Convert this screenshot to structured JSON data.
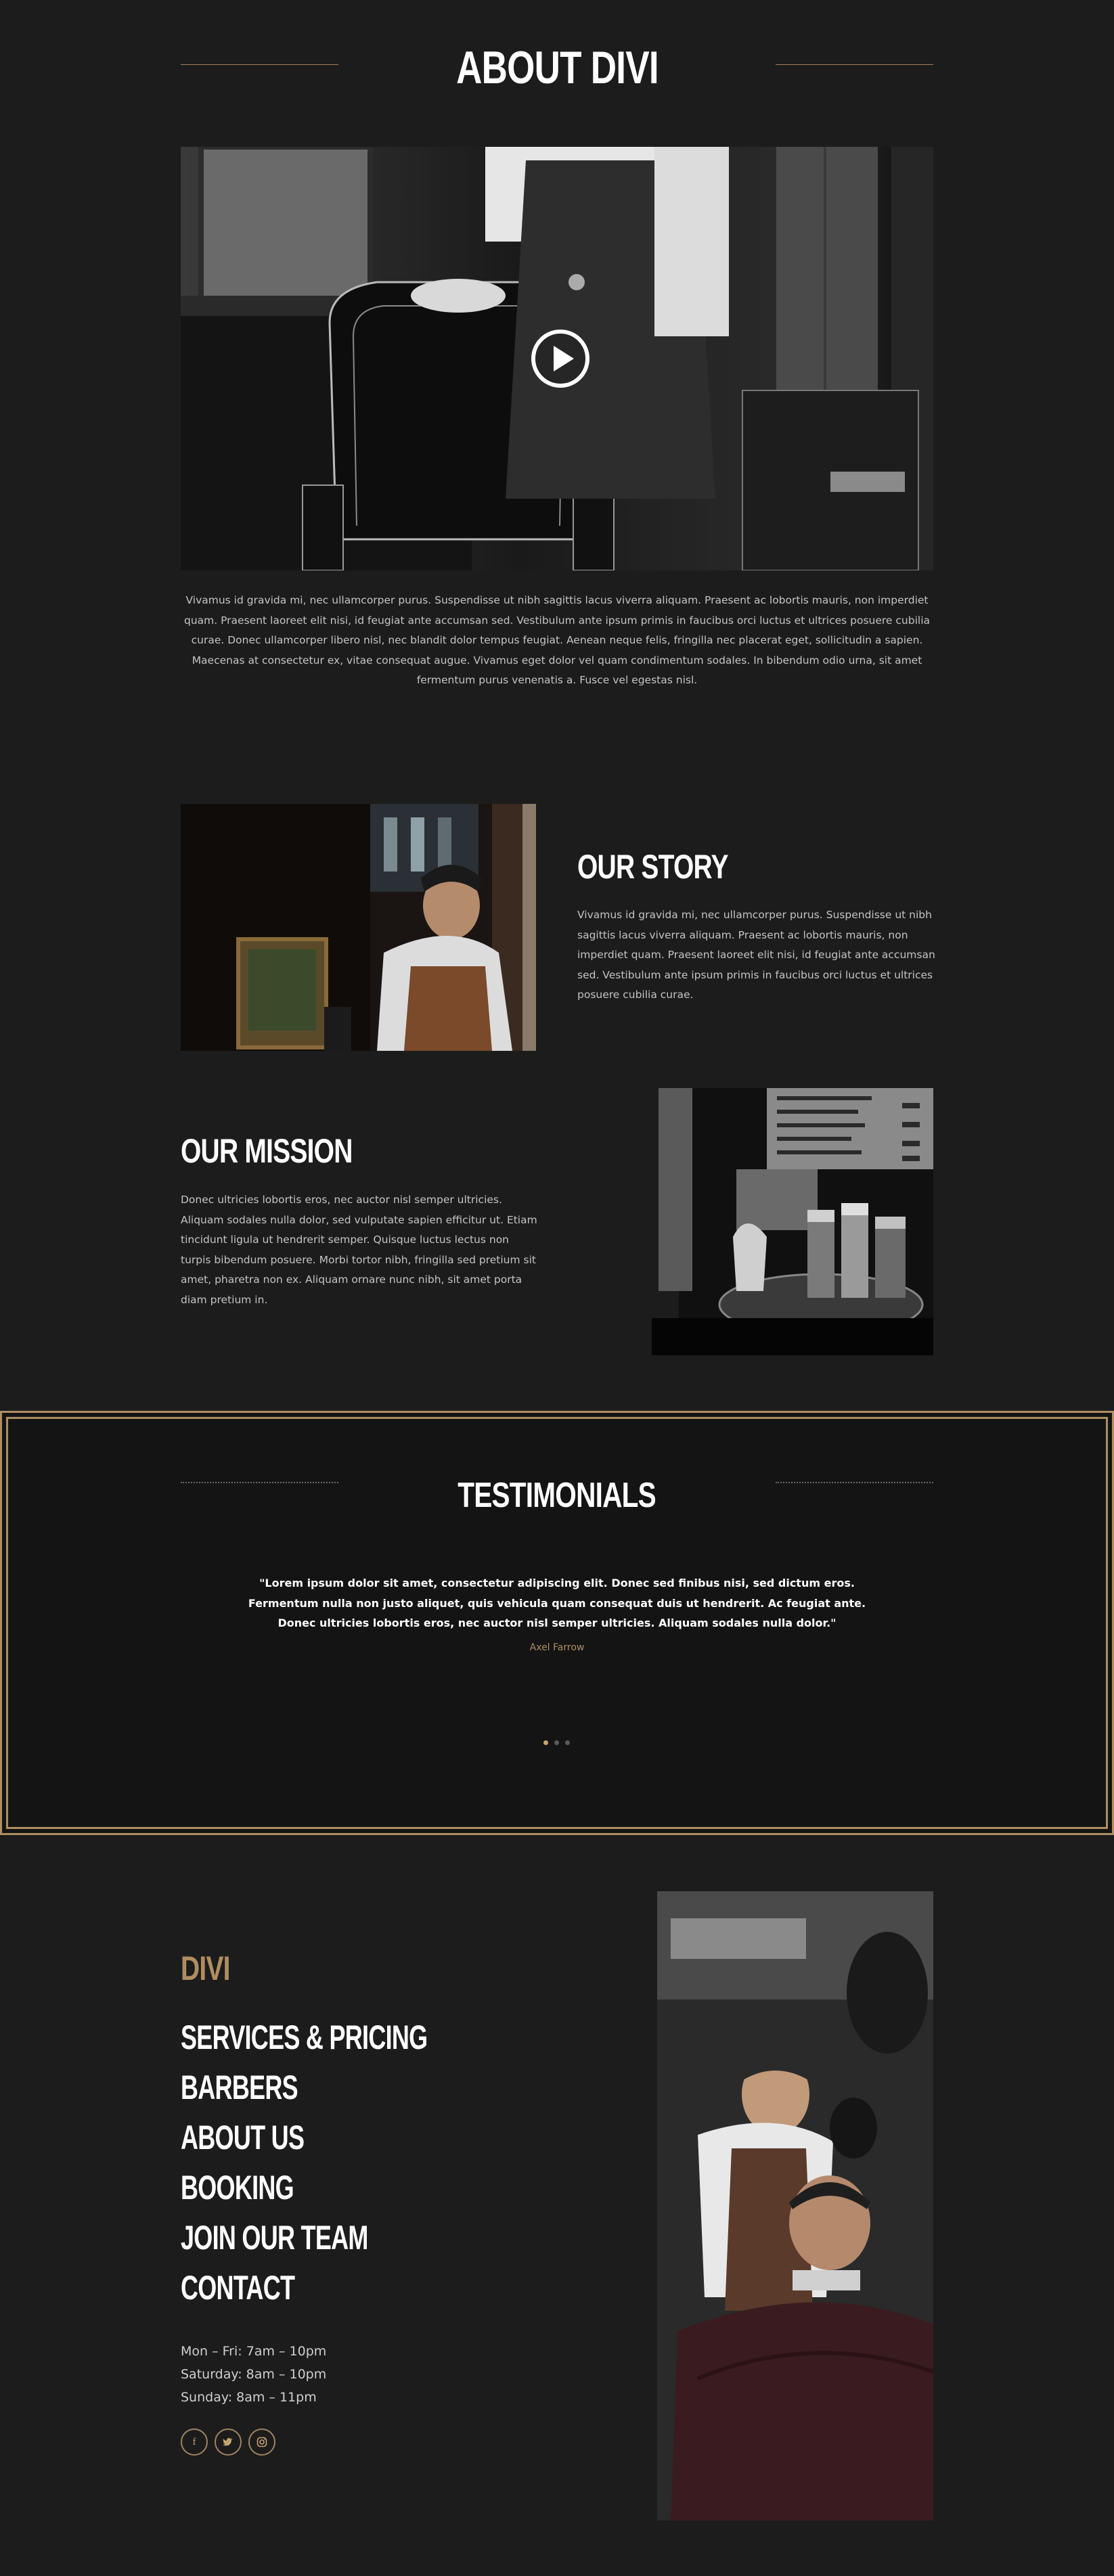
{
  "about": {
    "title": "ABOUT DIVI",
    "paragraph_lines": [
      "Vivamus id gravida mi, nec ullamcorper purus. Suspendisse ut nibh sagittis lacus viverra aliquam. Praesent ac lobortis mauris, non imperdiet",
      "quam. Praesent laoreet elit nisi, id feugiat ante accumsan sed. Vestibulum ante ipsum primis in faucibus orci luctus et ultrices posuere cubilia",
      "curae. Donec ullamcorper libero nisl, nec blandit dolor tempus feugiat. Aenean neque felis, fringilla nec placerat eget, sollicitudin a sapien.",
      "Maecenas at consectetur ex, vitae consequat augue. Vivamus eget dolor vel quam condimentum sodales. In bibendum odio urna, sit amet",
      "fermentum purus venenatis a. Fusce vel egestas nisl."
    ],
    "video_icon": "play-icon"
  },
  "story": {
    "title": "OUR STORY",
    "paragraph_lines": [
      "Vivamus id gravida mi, nec ullamcorper purus. Suspendisse ut nibh",
      "sagittis lacus viverra aliquam. Praesent ac lobortis mauris, non",
      "imperdiet quam. Praesent laoreet elit nisi, id feugiat ante accumsan",
      "sed. Vestibulum ante ipsum primis in faucibus orci luctus et ultrices",
      "posuere cubilia curae."
    ]
  },
  "mission": {
    "title": "OUR MISSION",
    "paragraph_lines": [
      "Donec ultricies lobortis eros, nec auctor nisl semper ultricies.",
      "Aliquam sodales nulla dolor, sed vulputate sapien efficitur ut. Etiam",
      "tincidunt ligula ut hendrerit semper. Quisque luctus lectus non",
      "turpis bibendum posuere. Morbi tortor nibh, fringilla sed pretium sit",
      "amet, pharetra non ex. Aliquam ornare nunc nibh, sit amet porta",
      "diam pretium in."
    ]
  },
  "testimonials": {
    "title": "TESTIMONIALS",
    "quote_lines": [
      "\"Lorem ipsum dolor sit amet, consectetur adipiscing elit. Donec sed finibus nisi, sed dictum eros.",
      "Fermentum nulla non justo aliquet, quis vehicula quam consequat duis ut hendrerit. Ac feugiat ante.",
      "Donec ultricies lobortis eros, nec auctor nisl semper ultricies. Aliquam sodales nulla dolor.\""
    ],
    "author": "Axel Farrow",
    "slide_count": 3,
    "active_slide": 1
  },
  "footer": {
    "brand": "DIVI",
    "menu": [
      "SERVICES & PRICING",
      "BARBERS",
      "ABOUT US",
      "BOOKING",
      "JOIN OUR TEAM",
      "CONTACT"
    ],
    "hours": [
      "Mon – Fri: 7am – 10pm",
      "Saturday: 8am – 10pm",
      "Sunday: 8am – 11pm"
    ],
    "social": [
      {
        "icon": "facebook-icon",
        "glyph": "f"
      },
      {
        "icon": "twitter-icon",
        "glyph": "🐦"
      },
      {
        "icon": "instagram-icon",
        "glyph": "◎"
      }
    ]
  },
  "colors": {
    "background": "#1c1c1c",
    "testimonial_bg": "#141414",
    "accent_gold": "#b08d60",
    "heading": "#ffffff"
  }
}
